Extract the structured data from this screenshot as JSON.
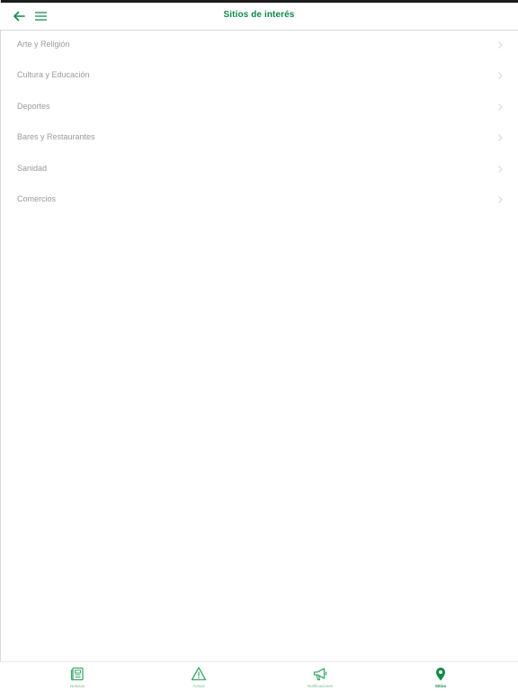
{
  "header": {
    "title": "Sitios de interés",
    "back_icon": "arrow-left-icon",
    "menu_icon": "hamburger-menu-icon"
  },
  "categories": [
    {
      "label": "Arte y Religión"
    },
    {
      "label": "Cultura y Educación"
    },
    {
      "label": "Deportes"
    },
    {
      "label": "Bares y Restaurantes"
    },
    {
      "label": "Sanidad"
    },
    {
      "label": "Comercios"
    }
  ],
  "tabs": [
    {
      "label": "Noticias",
      "icon": "newspaper-icon",
      "active": false
    },
    {
      "label": "Avisos",
      "icon": "warning-triangle-icon",
      "active": false
    },
    {
      "label": "Notificaciones",
      "icon": "megaphone-icon",
      "active": false
    },
    {
      "label": "Sitios",
      "icon": "map-pin-icon",
      "active": true
    }
  ],
  "colors": {
    "accent": "#0f8a48",
    "accent_light": "#6fbf8f",
    "item_text": "#9a9a9a",
    "divider": "#d9d9d9"
  }
}
